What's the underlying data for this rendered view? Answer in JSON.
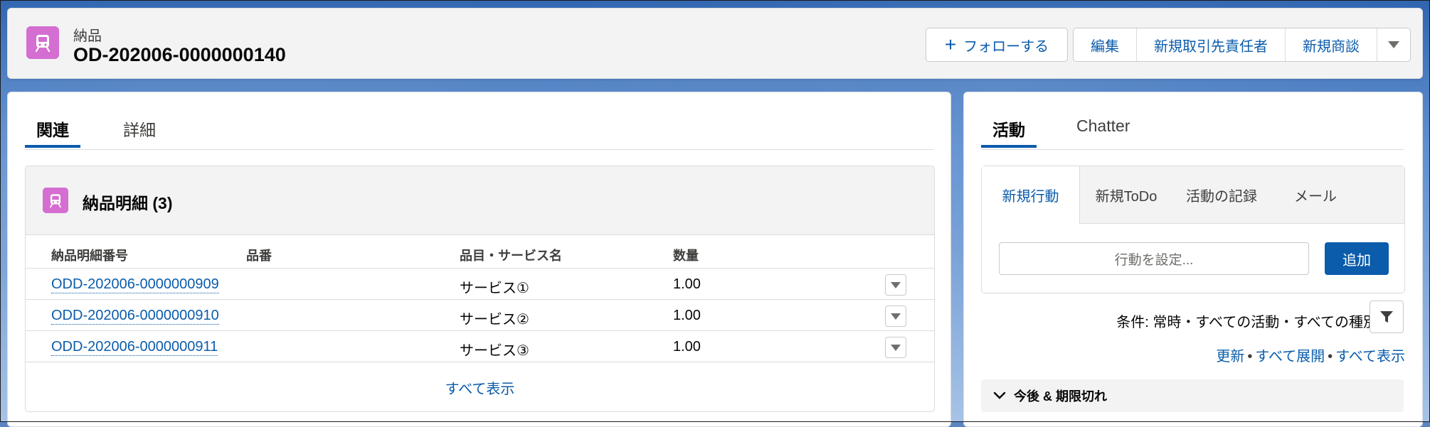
{
  "colors": {
    "brand": "#0b5cab",
    "object_icon": "#d46ed1"
  },
  "record": {
    "object_type": "納品",
    "title": "OD-202006-0000000140",
    "icon": "train-icon"
  },
  "header_actions": {
    "follow_label": "フォローする",
    "buttons": [
      "編集",
      "新規取引先責任者",
      "新規商談"
    ],
    "more_icon": "chevron-down-icon"
  },
  "left_tabs": [
    "関連",
    "詳細"
  ],
  "related_list": {
    "title": "納品明細 (3)",
    "icon": "train-icon",
    "columns": [
      "納品明細番号",
      "品番",
      "品目・サービス名",
      "数量"
    ],
    "rows": [
      {
        "number": "ODD-202006-0000000909",
        "part": "",
        "item": "サービス①",
        "qty": "1.00"
      },
      {
        "number": "ODD-202006-0000000910",
        "part": "",
        "item": "サービス②",
        "qty": "1.00"
      },
      {
        "number": "ODD-202006-0000000911",
        "part": "",
        "item": "サービス③",
        "qty": "1.00"
      }
    ],
    "view_all": "すべて表示"
  },
  "right_tabs": [
    "活動",
    "Chatter"
  ],
  "activity": {
    "subtabs": [
      "新規行動",
      "新規ToDo",
      "活動の記録",
      "メール"
    ],
    "input_placeholder": "行動を設定...",
    "add_label": "追加",
    "filter_text": "条件: 常時・すべての活動・すべての種別",
    "links": [
      "更新",
      "すべて展開",
      "すべて表示"
    ],
    "section_label": "今後 & 期限切れ"
  }
}
